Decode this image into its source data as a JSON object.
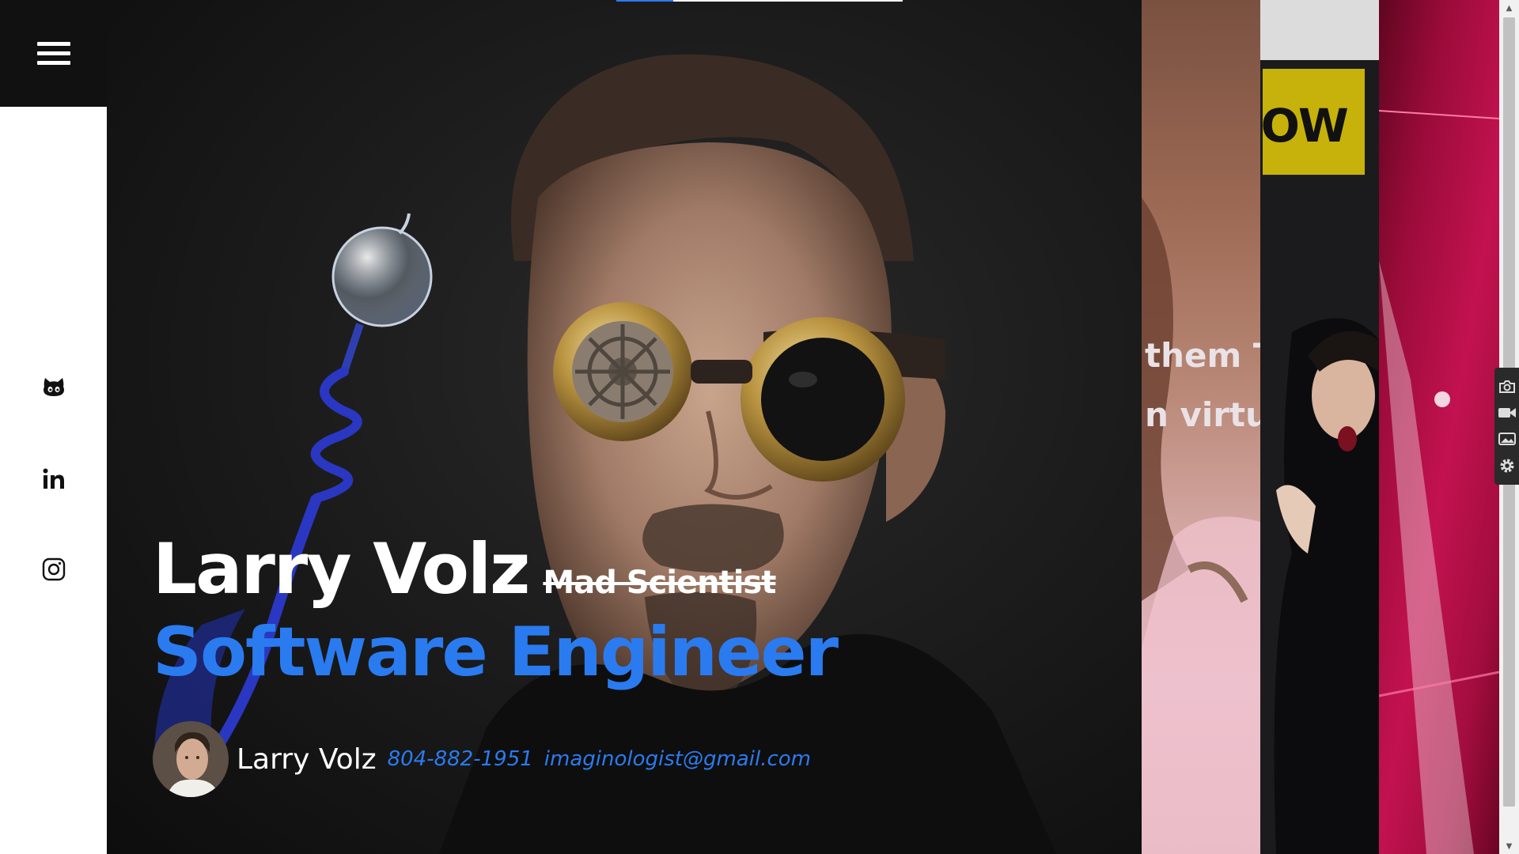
{
  "nav": {
    "menu_icon": "hamburger-menu-icon",
    "social": [
      {
        "name": "github",
        "icon": "github-icon"
      },
      {
        "name": "linkedin",
        "icon": "linkedin-icon"
      },
      {
        "name": "instagram",
        "icon": "instagram-icon"
      }
    ]
  },
  "hero": {
    "name": "Larry Volz",
    "struck_title": "Mad Scientist",
    "role": "Software Engineer",
    "progress": 0.2,
    "contact": {
      "name": "Larry Volz",
      "phone": "804-882-1951",
      "email": "imaginologist@gmail.com"
    }
  },
  "slides": {
    "caption_lines": [
      "them T",
      "n virtu"
    ],
    "banner_text": "IOW"
  },
  "tools": [
    "camera-icon",
    "video-icon",
    "image-icon",
    "settings-icon"
  ],
  "colors": {
    "accent": "#2a7bf0",
    "menu_bg": "#111111",
    "hero_text": "#ffffff"
  }
}
